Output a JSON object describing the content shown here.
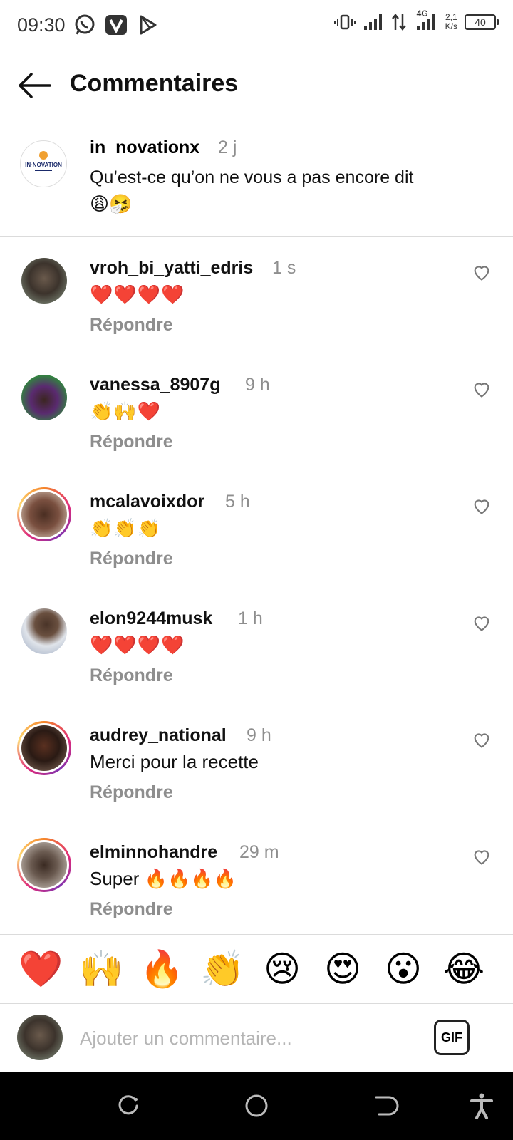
{
  "status_bar": {
    "time": "09:30",
    "icons_left": [
      "whatsapp-icon",
      "vivaldi-icon",
      "play-store-icon"
    ],
    "network_type": "4G",
    "net_speed_value": "2,1",
    "net_speed_unit": "K/s",
    "battery": "40"
  },
  "header": {
    "title": "Commentaires"
  },
  "caption": {
    "username": "in_novationx",
    "time": "2 j",
    "text": "Qu’est-ce qu’on ne vous a pas encore dit",
    "emoji": "😩🤧"
  },
  "comments": [
    {
      "username": "vroh_bi_yatti_edris",
      "time": "1 s",
      "text": "❤️❤️❤️❤️",
      "reply": "Répondre"
    },
    {
      "username": "vanessa_8907g",
      "time": "9 h",
      "text": "👏🙌❤️",
      "reply": "Répondre"
    },
    {
      "username": "mcalavoixdor",
      "time": "5 h",
      "text": "👏👏👏",
      "reply": "Répondre"
    },
    {
      "username": "elon9244musk",
      "time": "1 h",
      "text": "❤️❤️❤️❤️",
      "reply": "Répondre"
    },
    {
      "username": "audrey_national",
      "time": "9 h",
      "text": "Merci pour la recette",
      "reply": "Répondre"
    },
    {
      "username": "elminnohandre",
      "time": "29 m",
      "text": "Super 🔥🔥🔥🔥",
      "reply": "Répondre"
    }
  ],
  "reactions": [
    "❤️",
    "🙌",
    "🔥",
    "👏",
    "😢",
    "😍",
    "😮",
    "😂"
  ],
  "input": {
    "placeholder": "Ajouter un commentaire...",
    "gif_label": "GIF"
  },
  "colors": {
    "secondary_text": "#8e8e8e",
    "divider": "#dbdbdb",
    "story_ring_start": "#f58529",
    "story_ring_end": "#dd2a7b"
  }
}
